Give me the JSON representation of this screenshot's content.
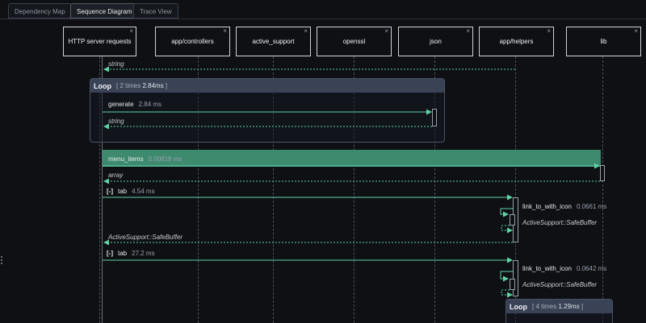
{
  "tabs": [
    {
      "label": "Dependency Map",
      "active": false
    },
    {
      "label": "Sequence Diagram",
      "active": true
    },
    {
      "label": "Trace View",
      "active": false
    }
  ],
  "actors": [
    "HTTP server requests",
    "app/controllers",
    "active_support",
    "openssl",
    "json",
    "app/helpers",
    "lib"
  ],
  "close_glyph": "×",
  "messages": {
    "ret_string_top": "string",
    "loop1": {
      "title": "Loop",
      "meta_prefix": "[ 2 times ",
      "meta_value": "2.84ms",
      "meta_suffix": " ]"
    },
    "generate": {
      "name": "generate",
      "duration": "2.84 ms"
    },
    "ret_string_loop": "string",
    "menu_items": {
      "name": "menu_items",
      "duration": "0.00818 ms"
    },
    "ret_array": "array",
    "tab1": {
      "toggle": "[-]",
      "name": "tab",
      "duration": "4.54 ms"
    },
    "link1": {
      "name": "link_to_with_icon",
      "duration": "0.0661 ms"
    },
    "ret_safe1": "ActiveSupport::SafeBuffer",
    "ret_safe_to_http": "ActiveSupport::SafeBuffer",
    "tab2": {
      "toggle": "[-]",
      "name": "tab",
      "duration": "27.2 ms"
    },
    "link2": {
      "name": "link_to_with_icon",
      "duration": "0.0642 ms"
    },
    "ret_safe2": "ActiveSupport::SafeBuffer",
    "loop2": {
      "title": "Loop",
      "meta_prefix": "[ 4 times ",
      "meta_value": "1.29ms",
      "meta_suffix": " ]"
    }
  },
  "colors": {
    "arrow": "#5fd3a8",
    "highlight": "#3d8a6e",
    "loop_header": "#3a4256"
  }
}
